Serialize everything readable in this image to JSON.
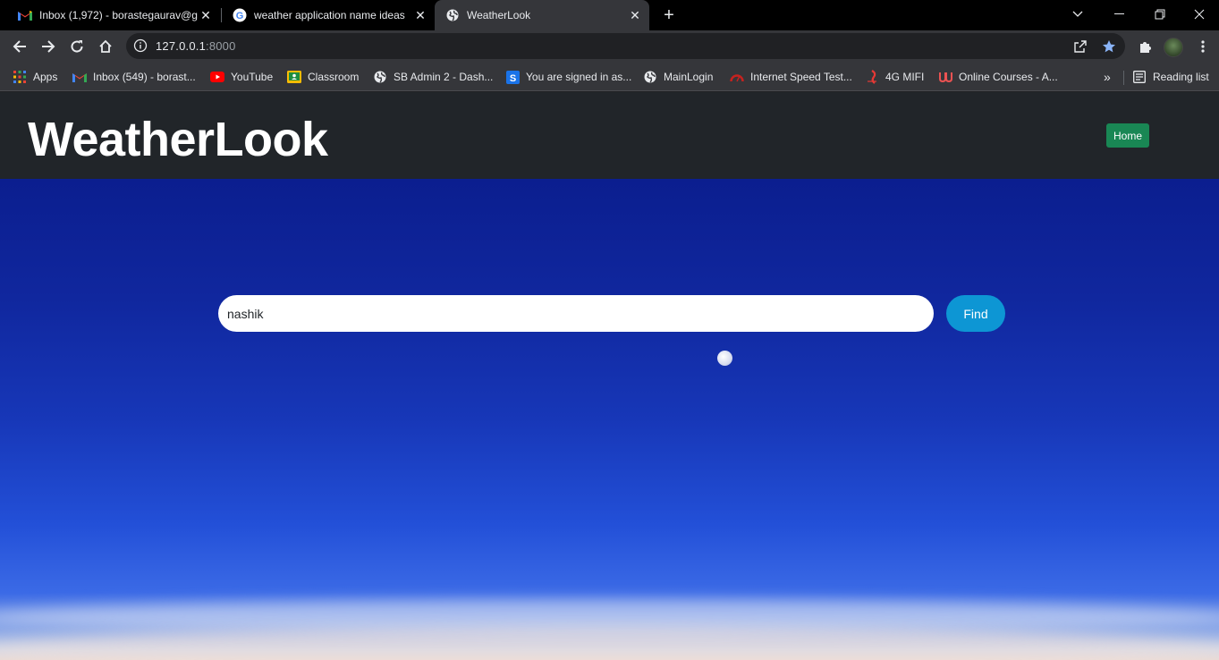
{
  "browser": {
    "tabs": [
      {
        "title": "Inbox (1,972) - borastegaurav@g",
        "favicon": "gmail-icon",
        "active": false
      },
      {
        "title": "weather application name ideas",
        "favicon": "google-icon",
        "active": false
      },
      {
        "title": "WeatherLook",
        "favicon": "globe-icon",
        "active": true
      }
    ],
    "address_bar": {
      "host": "127.0.0.1",
      "port": ":8000"
    },
    "bookmarks": [
      {
        "label": "Apps",
        "icon": "apps-grid-icon"
      },
      {
        "label": "Inbox (549) - borast...",
        "icon": "gmail-icon"
      },
      {
        "label": "YouTube",
        "icon": "youtube-icon"
      },
      {
        "label": "Classroom",
        "icon": "classroom-icon"
      },
      {
        "label": "SB Admin 2 - Dash...",
        "icon": "globe-icon"
      },
      {
        "label": "You are signed in as...",
        "icon": "s-logo-icon"
      },
      {
        "label": "MainLogin",
        "icon": "globe-icon"
      },
      {
        "label": "Internet Speed Test...",
        "icon": "speedometer-icon"
      },
      {
        "label": "4G MIFI",
        "icon": "airtel-icon"
      },
      {
        "label": "Online Courses - A...",
        "icon": "udemy-icon"
      }
    ],
    "reading_list": "Reading list"
  },
  "app": {
    "brand": "WeatherLook",
    "nav": {
      "home_label": "Home"
    },
    "search": {
      "value": "nashik",
      "placeholder": ""
    },
    "find_label": "Find"
  },
  "colors": {
    "navbar_bg": "#212529",
    "home_button": "#198754",
    "find_button": "#0d96d4",
    "sky_top": "#0b1e8f",
    "sky_bottom": "#3b6ae6"
  }
}
